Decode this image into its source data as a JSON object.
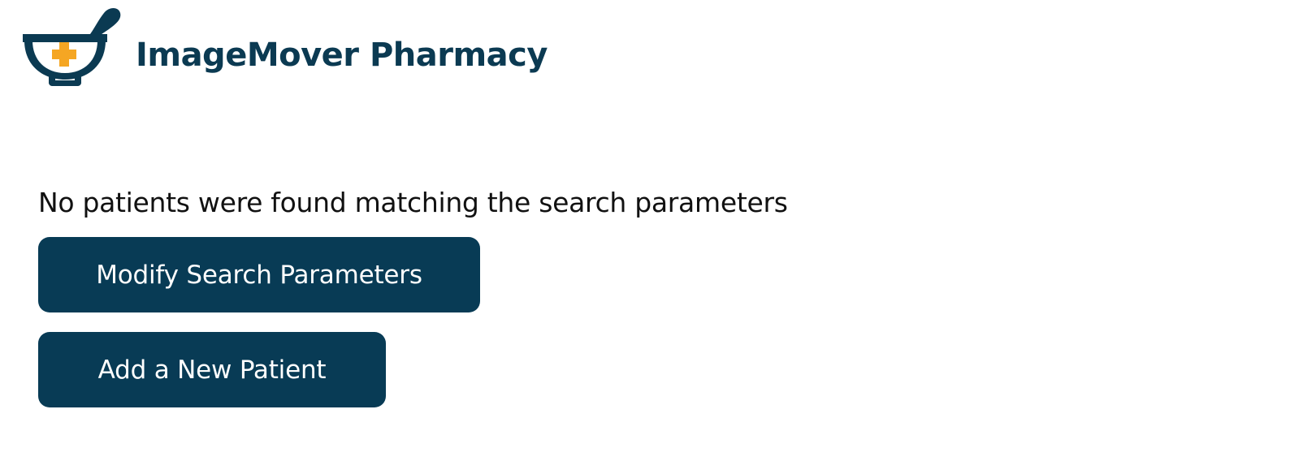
{
  "header": {
    "brand_name": "ImageMover Pharmacy",
    "logo_icon": "mortar-pestle-cross-icon"
  },
  "main": {
    "message": "No patients were found matching the search parameters",
    "modify_button_label": "Modify Search Parameters",
    "add_button_label": "Add a New Patient"
  },
  "colors": {
    "brand_dark": "#0b3a52",
    "button_bg": "#083b55",
    "accent_orange": "#f5a623",
    "text": "#111111"
  }
}
